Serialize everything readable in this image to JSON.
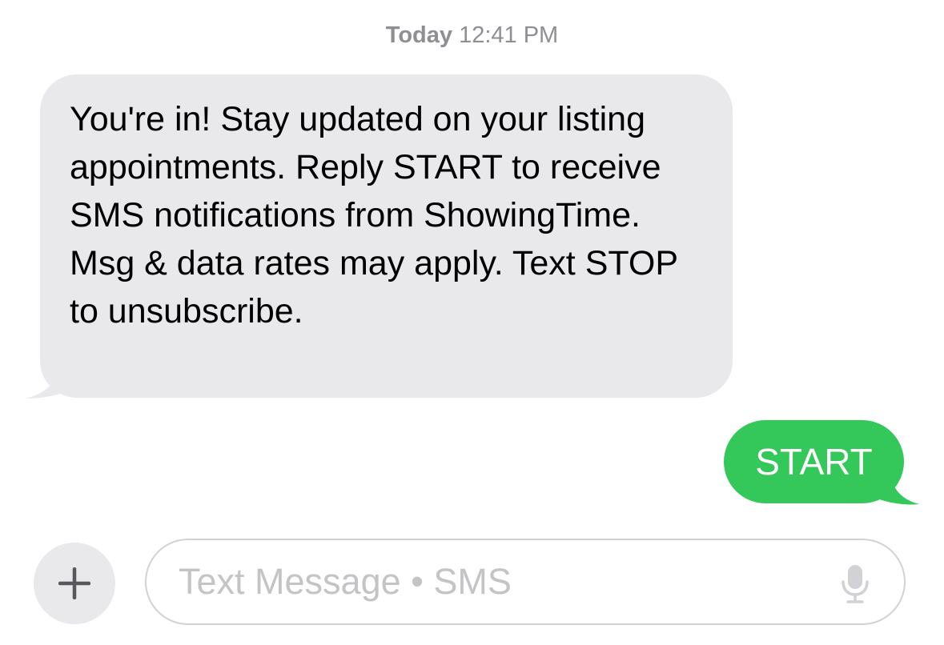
{
  "conversation": {
    "timestamp_day": "Today",
    "timestamp_time": "12:41 PM",
    "received_message": "You're in! Stay updated on your listing appointments. Reply START to receive SMS notifications from ShowingTime. Msg & data rates may apply. Text STOP to unsubscribe.",
    "sent_message": "START"
  },
  "compose": {
    "placeholder": "Text Message • SMS",
    "plus_icon": "plus-icon",
    "mic_icon": "microphone-icon"
  },
  "colors": {
    "received_bubble": "#e9e9eb",
    "sent_bubble": "#34c759",
    "timestamp": "#8e8e93",
    "placeholder": "#c4c4c7"
  }
}
